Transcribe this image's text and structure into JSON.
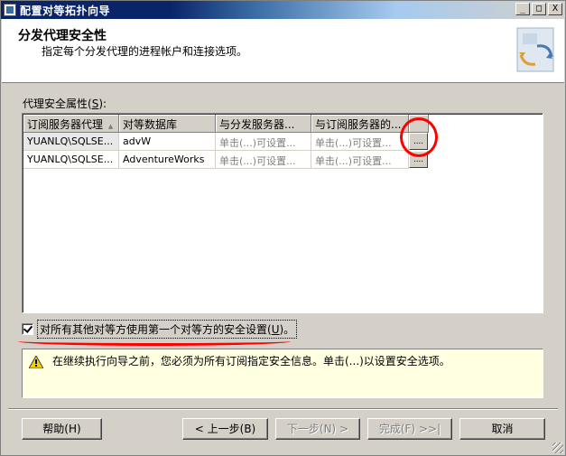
{
  "window": {
    "title": "配置对等拓扑向导"
  },
  "title_buttons": {
    "minimize": "_",
    "restore": "□",
    "close": "X"
  },
  "header": {
    "title": "分发代理安全性",
    "subtitle": "指定每个分发代理的进程帐户和连接选项。"
  },
  "group_label": {
    "text": "代理安全属性(",
    "accel": "S",
    "end": "):"
  },
  "grid": {
    "columns": [
      "订阅服务器代理",
      "对等数据库",
      "与分发服务器...",
      "与订阅服务器的..."
    ],
    "rows": [
      [
        "YUANLQ\\SQLSE...",
        "advW",
        "单击(...)可设置...",
        "单击(...)可设置..."
      ],
      [
        "YUANLQ\\SQLSE...",
        "AdventureWorks",
        "单击(...)可设置...",
        "单击(...)可设置..."
      ]
    ],
    "ellipsis": "....",
    "sort_glyph": "▲"
  },
  "checkbox": {
    "label": "对所有其他对等方使用第一个对等方的安全设置(",
    "accel": "U",
    "end": ")。",
    "checked": true
  },
  "warning": {
    "text": "在继续执行向导之前，您必须为所有订阅指定安全信息。单击(...)以设置安全选项。"
  },
  "buttons": {
    "help": "帮助(H)",
    "back": "< 上一步(B)",
    "next": "下一步(N) >",
    "finish": "完成(F) >>|",
    "cancel": "取消"
  },
  "colors": {
    "annotation": "#ff0000",
    "title_bar": "#0a246a",
    "warning_bg": "#ffffe1"
  }
}
